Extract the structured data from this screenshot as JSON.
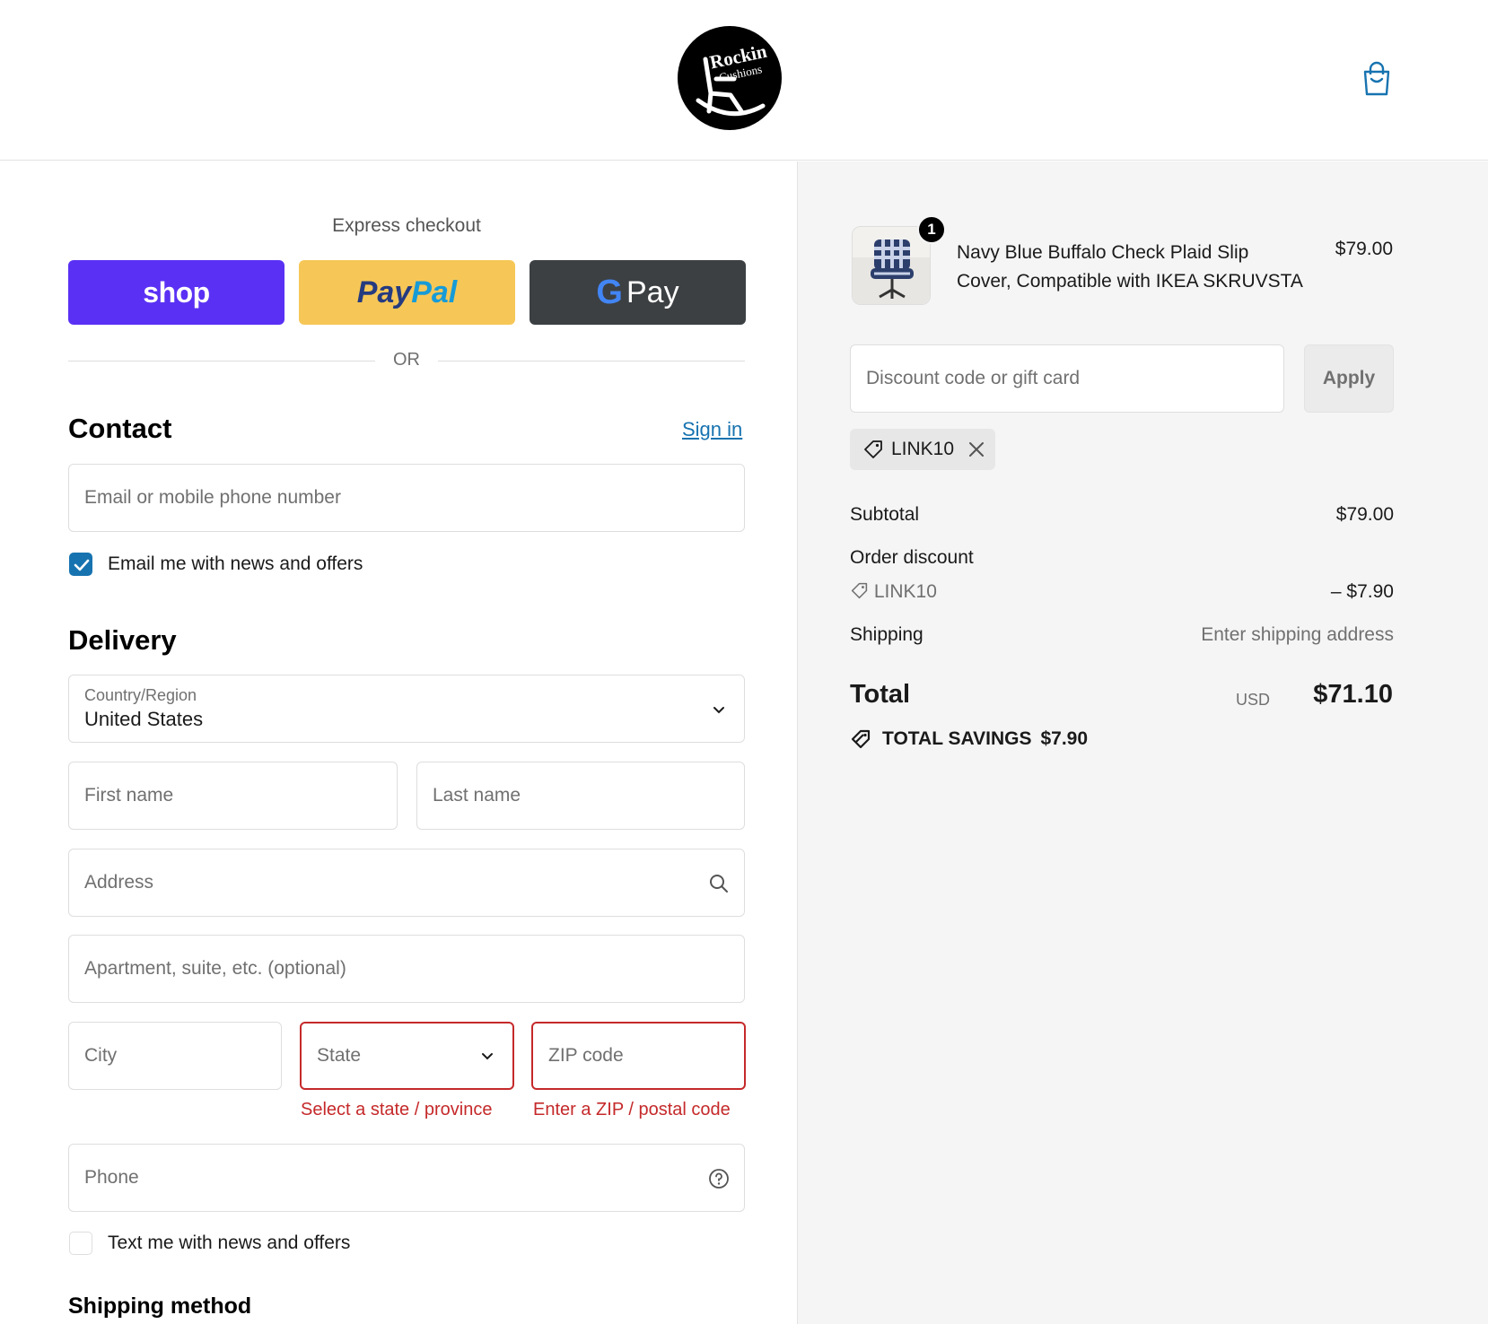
{
  "header": {
    "logo_line1": "Rockin",
    "logo_line2": "Cushions"
  },
  "express": {
    "title": "Express checkout",
    "shop_label": "shop",
    "paypal_label_1": "Pay",
    "paypal_label_2": "Pal",
    "gpay_g": "G",
    "gpay_label": "Pay",
    "or_text": "OR"
  },
  "contact": {
    "heading": "Contact",
    "sign_in": "Sign in",
    "email_placeholder": "Email or mobile phone number",
    "news_label": "Email me with news and offers",
    "news_checked": true
  },
  "delivery": {
    "heading": "Delivery",
    "country_label": "Country/Region",
    "country_value": "United States",
    "first_name_placeholder": "First name",
    "last_name_placeholder": "Last name",
    "address_placeholder": "Address",
    "apartment_placeholder": "Apartment, suite, etc. (optional)",
    "city_placeholder": "City",
    "state_placeholder": "State",
    "zip_placeholder": "ZIP code",
    "state_error": "Select a state / province",
    "zip_error": "Enter a ZIP / postal code",
    "phone_placeholder": "Phone",
    "text_label": "Text me with news and offers",
    "text_checked": false
  },
  "shipping_method": {
    "heading": "Shipping method"
  },
  "summary": {
    "item": {
      "quantity": "1",
      "name": "Navy Blue Buffalo Check Plaid Slip Cover, Compatible with IKEA SKRUVSTA",
      "price": "$79.00"
    },
    "discount_placeholder": "Discount code or gift card",
    "apply_label": "Apply",
    "applied_code": "LINK10",
    "subtotal_label": "Subtotal",
    "subtotal_value": "$79.00",
    "order_discount_label": "Order discount",
    "discount_code": "LINK10",
    "discount_value": "– $7.90",
    "shipping_label": "Shipping",
    "shipping_value": "Enter shipping address",
    "total_label": "Total",
    "currency": "USD",
    "total_value": "$71.10",
    "savings_label": "TOTAL SAVINGS",
    "savings_value": "$7.90"
  },
  "colors": {
    "shop_brand": "#5a31f4",
    "paypal_brand": "#f6c757",
    "gpay_brand": "#3c4043",
    "link": "#1773b0",
    "error": "#c5292a"
  }
}
